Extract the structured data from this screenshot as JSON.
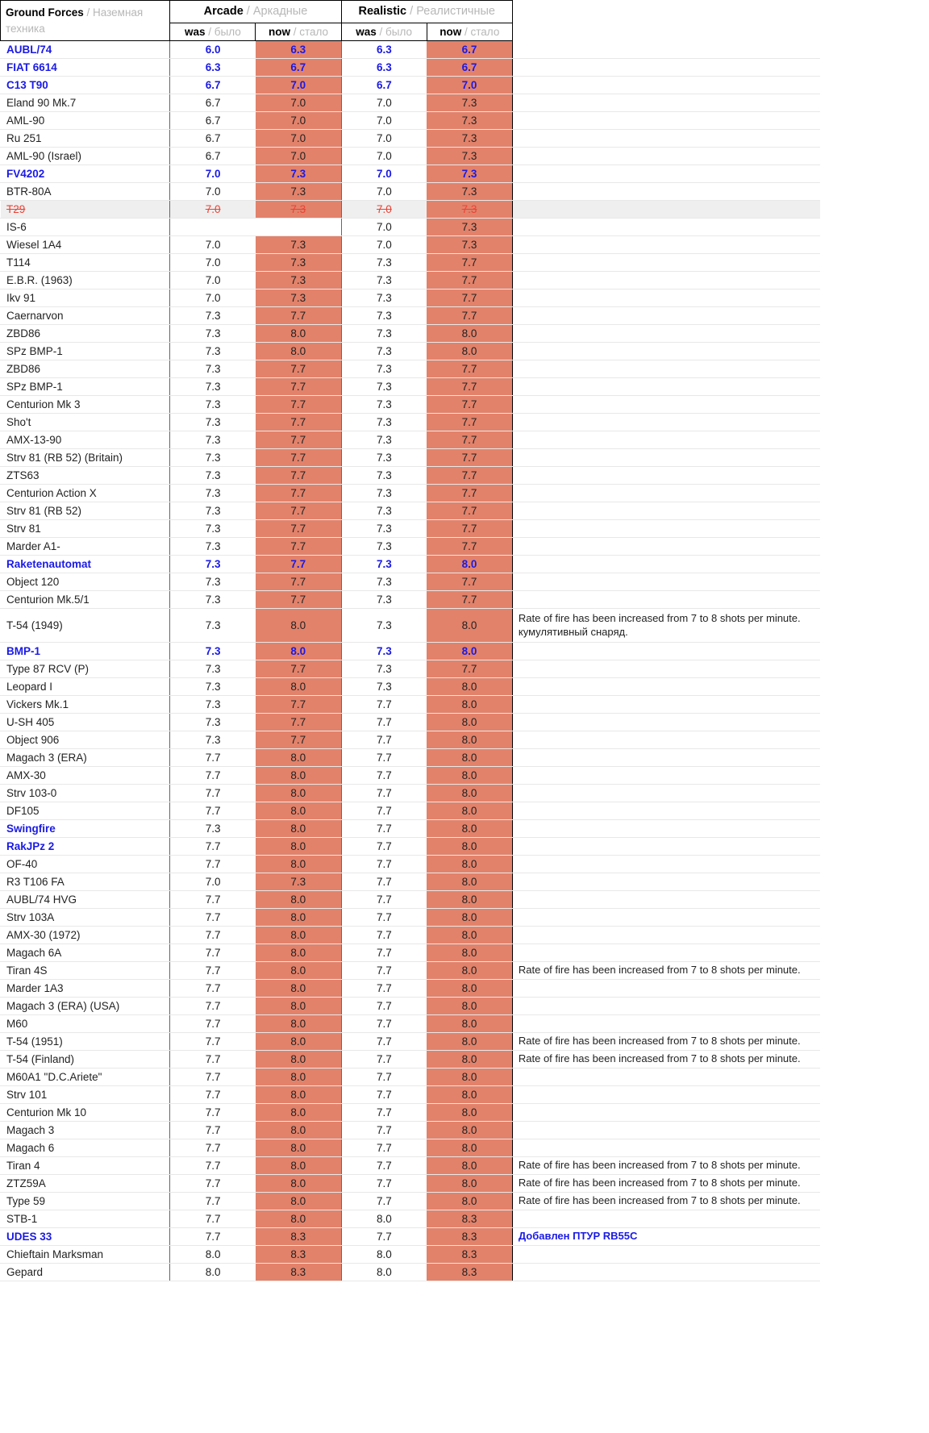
{
  "header": {
    "name_col": {
      "en": "Ground Forces",
      "sep": " / ",
      "ru": "Наземная техника"
    },
    "groups": [
      {
        "en": "Arcade",
        "sep": " / ",
        "ru": "Аркадные"
      },
      {
        "en": "Realistic",
        "sep": " / ",
        "ru": "Реалистичные"
      }
    ],
    "subs": [
      {
        "en": "was",
        "sep": " / ",
        "ru": "было"
      },
      {
        "en": "now",
        "sep": " / ",
        "ru": "стало"
      },
      {
        "en": "was",
        "sep": " / ",
        "ru": "было"
      },
      {
        "en": "now",
        "sep": " / ",
        "ru": "стало"
      }
    ]
  },
  "colors": {
    "highlight": "#e2826b",
    "blue": "#1a1ae6",
    "strike_red": "#ea4335",
    "grey_row": "#efefef"
  },
  "comments": {
    "rof": "Rate of fire has been increased from 7 to 8 shots per minute.",
    "rof_ru_extra": "кумулятивный снаряд.",
    "udes": "Добавлен ПТУР RB55C"
  },
  "rows": [
    {
      "name": "AUBL/74",
      "aw": "6.0",
      "an": "6.3",
      "rw": "6.3",
      "rn": "6.7",
      "cmt": "",
      "style": "blue"
    },
    {
      "name": "FIAT 6614",
      "aw": "6.3",
      "an": "6.7",
      "rw": "6.3",
      "rn": "6.7",
      "cmt": "",
      "style": "blue"
    },
    {
      "name": "C13 T90",
      "aw": "6.7",
      "an": "7.0",
      "rw": "6.7",
      "rn": "7.0",
      "cmt": "",
      "style": "blue"
    },
    {
      "name": "Eland 90 Mk.7",
      "aw": "6.7",
      "an": "7.0",
      "rw": "7.0",
      "rn": "7.3",
      "cmt": "",
      "style": ""
    },
    {
      "name": "AML-90",
      "aw": "6.7",
      "an": "7.0",
      "rw": "7.0",
      "rn": "7.3",
      "cmt": "",
      "style": ""
    },
    {
      "name": "Ru 251",
      "aw": "6.7",
      "an": "7.0",
      "rw": "7.0",
      "rn": "7.3",
      "cmt": "",
      "style": ""
    },
    {
      "name": "AML-90 (Israel)",
      "aw": "6.7",
      "an": "7.0",
      "rw": "7.0",
      "rn": "7.3",
      "cmt": "",
      "style": ""
    },
    {
      "name": "FV4202",
      "aw": "7.0",
      "an": "7.3",
      "rw": "7.0",
      "rn": "7.3",
      "cmt": "",
      "style": "blue"
    },
    {
      "name": "BTR-80A",
      "aw": "7.0",
      "an": "7.3",
      "rw": "7.0",
      "rn": "7.3",
      "cmt": "",
      "style": ""
    },
    {
      "name": "T29",
      "aw": "7.0",
      "an": "7.3",
      "rw": "7.0",
      "rn": "7.3",
      "cmt": "",
      "style": "strike"
    },
    {
      "name": "IS-6",
      "aw": "",
      "an": "",
      "rw": "7.0",
      "rn": "7.3",
      "cmt": "",
      "style": "empty-arcade"
    },
    {
      "name": "Wiesel 1A4",
      "aw": "7.0",
      "an": "7.3",
      "rw": "7.0",
      "rn": "7.3",
      "cmt": "",
      "style": ""
    },
    {
      "name": "T114",
      "aw": "7.0",
      "an": "7.3",
      "rw": "7.3",
      "rn": "7.7",
      "cmt": "",
      "style": ""
    },
    {
      "name": "E.B.R. (1963)",
      "aw": "7.0",
      "an": "7.3",
      "rw": "7.3",
      "rn": "7.7",
      "cmt": "",
      "style": ""
    },
    {
      "name": "Ikv 91",
      "aw": "7.0",
      "an": "7.3",
      "rw": "7.3",
      "rn": "7.7",
      "cmt": "",
      "style": ""
    },
    {
      "name": "Caernarvon",
      "aw": "7.3",
      "an": "7.7",
      "rw": "7.3",
      "rn": "7.7",
      "cmt": "",
      "style": ""
    },
    {
      "name": "ZBD86",
      "aw": "7.3",
      "an": "8.0",
      "rw": "7.3",
      "rn": "8.0",
      "cmt": "",
      "style": ""
    },
    {
      "name": "SPz BMP-1",
      "aw": "7.3",
      "an": "8.0",
      "rw": "7.3",
      "rn": "8.0",
      "cmt": "",
      "style": ""
    },
    {
      "name": "ZBD86",
      "aw": "7.3",
      "an": "7.7",
      "rw": "7.3",
      "rn": "7.7",
      "cmt": "",
      "style": ""
    },
    {
      "name": "SPz BMP-1",
      "aw": "7.3",
      "an": "7.7",
      "rw": "7.3",
      "rn": "7.7",
      "cmt": "",
      "style": ""
    },
    {
      "name": "Centurion Mk 3",
      "aw": "7.3",
      "an": "7.7",
      "rw": "7.3",
      "rn": "7.7",
      "cmt": "",
      "style": ""
    },
    {
      "name": "Sho't",
      "aw": "7.3",
      "an": "7.7",
      "rw": "7.3",
      "rn": "7.7",
      "cmt": "",
      "style": ""
    },
    {
      "name": "AMX-13-90",
      "aw": "7.3",
      "an": "7.7",
      "rw": "7.3",
      "rn": "7.7",
      "cmt": "",
      "style": ""
    },
    {
      "name": "Strv 81 (RB 52) (Britain)",
      "aw": "7.3",
      "an": "7.7",
      "rw": "7.3",
      "rn": "7.7",
      "cmt": "",
      "style": ""
    },
    {
      "name": "ZTS63",
      "aw": "7.3",
      "an": "7.7",
      "rw": "7.3",
      "rn": "7.7",
      "cmt": "",
      "style": ""
    },
    {
      "name": "Centurion Action X",
      "aw": "7.3",
      "an": "7.7",
      "rw": "7.3",
      "rn": "7.7",
      "cmt": "",
      "style": ""
    },
    {
      "name": "Strv 81 (RB 52)",
      "aw": "7.3",
      "an": "7.7",
      "rw": "7.3",
      "rn": "7.7",
      "cmt": "",
      "style": ""
    },
    {
      "name": "Strv 81",
      "aw": "7.3",
      "an": "7.7",
      "rw": "7.3",
      "rn": "7.7",
      "cmt": "",
      "style": ""
    },
    {
      "name": "Marder A1-",
      "aw": "7.3",
      "an": "7.7",
      "rw": "7.3",
      "rn": "7.7",
      "cmt": "",
      "style": ""
    },
    {
      "name": "Raketenautomat",
      "aw": "7.3",
      "an": "7.7",
      "rw": "7.3",
      "rn": "8.0",
      "cmt": "",
      "style": "blue"
    },
    {
      "name": "Object 120",
      "aw": "7.3",
      "an": "7.7",
      "rw": "7.3",
      "rn": "7.7",
      "cmt": "",
      "style": ""
    },
    {
      "name": "Centurion Mk.5/1",
      "aw": "7.3",
      "an": "7.7",
      "rw": "7.3",
      "rn": "7.7",
      "cmt": "",
      "style": ""
    },
    {
      "name": "T-54 (1949)",
      "aw": "7.3",
      "an": "8.0",
      "rw": "7.3",
      "rn": "8.0",
      "cmt": "Rate of fire has been increased from 7 to 8 shots per minute. кумулятивный снаряд.",
      "style": "tall"
    },
    {
      "name": "BMP-1",
      "aw": "7.3",
      "an": "8.0",
      "rw": "7.3",
      "rn": "8.0",
      "cmt": "",
      "style": "blue"
    },
    {
      "name": "Type 87 RCV (P)",
      "aw": "7.3",
      "an": "7.7",
      "rw": "7.3",
      "rn": "7.7",
      "cmt": "",
      "style": ""
    },
    {
      "name": "Leopard I",
      "aw": "7.3",
      "an": "8.0",
      "rw": "7.3",
      "rn": "8.0",
      "cmt": "",
      "style": ""
    },
    {
      "name": "Vickers Mk.1",
      "aw": "7.3",
      "an": "7.7",
      "rw": "7.7",
      "rn": "8.0",
      "cmt": "",
      "style": ""
    },
    {
      "name": "U-SH 405",
      "aw": "7.3",
      "an": "7.7",
      "rw": "7.7",
      "rn": "8.0",
      "cmt": "",
      "style": ""
    },
    {
      "name": "Object 906",
      "aw": "7.3",
      "an": "7.7",
      "rw": "7.7",
      "rn": "8.0",
      "cmt": "",
      "style": ""
    },
    {
      "name": "Magach 3 (ERA)",
      "aw": "7.7",
      "an": "8.0",
      "rw": "7.7",
      "rn": "8.0",
      "cmt": "",
      "style": ""
    },
    {
      "name": "AMX-30",
      "aw": "7.7",
      "an": "8.0",
      "rw": "7.7",
      "rn": "8.0",
      "cmt": "",
      "style": ""
    },
    {
      "name": "Strv 103-0",
      "aw": "7.7",
      "an": "8.0",
      "rw": "7.7",
      "rn": "8.0",
      "cmt": "",
      "style": ""
    },
    {
      "name": "DF105",
      "aw": "7.7",
      "an": "8.0",
      "rw": "7.7",
      "rn": "8.0",
      "cmt": "",
      "style": ""
    },
    {
      "name": "Swingfire",
      "aw": "7.3",
      "an": "8.0",
      "rw": "7.7",
      "rn": "8.0",
      "cmt": "",
      "style": "blue-name"
    },
    {
      "name": "RakJPz 2",
      "aw": "7.7",
      "an": "8.0",
      "rw": "7.7",
      "rn": "8.0",
      "cmt": "",
      "style": "blue-name"
    },
    {
      "name": "OF-40",
      "aw": "7.7",
      "an": "8.0",
      "rw": "7.7",
      "rn": "8.0",
      "cmt": "",
      "style": ""
    },
    {
      "name": "R3 T106 FA",
      "aw": "7.0",
      "an": "7.3",
      "rw": "7.7",
      "rn": "8.0",
      "cmt": "",
      "style": ""
    },
    {
      "name": "AUBL/74 HVG",
      "aw": "7.7",
      "an": "8.0",
      "rw": "7.7",
      "rn": "8.0",
      "cmt": "",
      "style": ""
    },
    {
      "name": "Strv 103A",
      "aw": "7.7",
      "an": "8.0",
      "rw": "7.7",
      "rn": "8.0",
      "cmt": "",
      "style": ""
    },
    {
      "name": "AMX-30 (1972)",
      "aw": "7.7",
      "an": "8.0",
      "rw": "7.7",
      "rn": "8.0",
      "cmt": "",
      "style": ""
    },
    {
      "name": "Magach 6A",
      "aw": "7.7",
      "an": "8.0",
      "rw": "7.7",
      "rn": "8.0",
      "cmt": "",
      "style": ""
    },
    {
      "name": "Tiran 4S",
      "aw": "7.7",
      "an": "8.0",
      "rw": "7.7",
      "rn": "8.0",
      "cmt": "Rate of fire has been increased from 7 to 8 shots per minute.",
      "style": ""
    },
    {
      "name": "Marder 1A3",
      "aw": "7.7",
      "an": "8.0",
      "rw": "7.7",
      "rn": "8.0",
      "cmt": "",
      "style": ""
    },
    {
      "name": "Magach 3 (ERA) (USA)",
      "aw": "7.7",
      "an": "8.0",
      "rw": "7.7",
      "rn": "8.0",
      "cmt": "",
      "style": ""
    },
    {
      "name": "M60",
      "aw": "7.7",
      "an": "8.0",
      "rw": "7.7",
      "rn": "8.0",
      "cmt": "",
      "style": ""
    },
    {
      "name": "T-54 (1951)",
      "aw": "7.7",
      "an": "8.0",
      "rw": "7.7",
      "rn": "8.0",
      "cmt": "Rate of fire has been increased from 7 to 8 shots per minute.",
      "style": ""
    },
    {
      "name": "T-54 (Finland)",
      "aw": "7.7",
      "an": "8.0",
      "rw": "7.7",
      "rn": "8.0",
      "cmt": "Rate of fire has been increased from 7 to 8 shots per minute.",
      "style": ""
    },
    {
      "name": "M60A1 \"D.C.Ariete\"",
      "aw": "7.7",
      "an": "8.0",
      "rw": "7.7",
      "rn": "8.0",
      "cmt": "",
      "style": ""
    },
    {
      "name": "Strv 101",
      "aw": "7.7",
      "an": "8.0",
      "rw": "7.7",
      "rn": "8.0",
      "cmt": "",
      "style": ""
    },
    {
      "name": "Centurion Mk 10",
      "aw": "7.7",
      "an": "8.0",
      "rw": "7.7",
      "rn": "8.0",
      "cmt": "",
      "style": ""
    },
    {
      "name": "Magach 3",
      "aw": "7.7",
      "an": "8.0",
      "rw": "7.7",
      "rn": "8.0",
      "cmt": "",
      "style": ""
    },
    {
      "name": "Magach 6",
      "aw": "7.7",
      "an": "8.0",
      "rw": "7.7",
      "rn": "8.0",
      "cmt": "",
      "style": ""
    },
    {
      "name": "Tiran 4",
      "aw": "7.7",
      "an": "8.0",
      "rw": "7.7",
      "rn": "8.0",
      "cmt": "Rate of fire has been increased from 7 to 8 shots per minute.",
      "style": ""
    },
    {
      "name": "ZTZ59A",
      "aw": "7.7",
      "an": "8.0",
      "rw": "7.7",
      "rn": "8.0",
      "cmt": "Rate of fire has been increased from 7 to 8 shots per minute.",
      "style": ""
    },
    {
      "name": "Type 59",
      "aw": "7.7",
      "an": "8.0",
      "rw": "7.7",
      "rn": "8.0",
      "cmt": "Rate of fire has been increased from 7 to 8 shots per minute.",
      "style": ""
    },
    {
      "name": "STB-1",
      "aw": "7.7",
      "an": "8.0",
      "rw": "8.0",
      "rn": "8.3",
      "cmt": "",
      "style": ""
    },
    {
      "name": "UDES 33",
      "aw": "7.7",
      "an": "8.3",
      "rw": "7.7",
      "rn": "8.3",
      "cmt": "Добавлен ПТУР RB55C",
      "style": "blue-name-cmt"
    },
    {
      "name": "Chieftain Marksman",
      "aw": "8.0",
      "an": "8.3",
      "rw": "8.0",
      "rn": "8.3",
      "cmt": "",
      "style": ""
    },
    {
      "name": "Gepard",
      "aw": "8.0",
      "an": "8.3",
      "rw": "8.0",
      "rn": "8.3",
      "cmt": "",
      "style": ""
    }
  ]
}
